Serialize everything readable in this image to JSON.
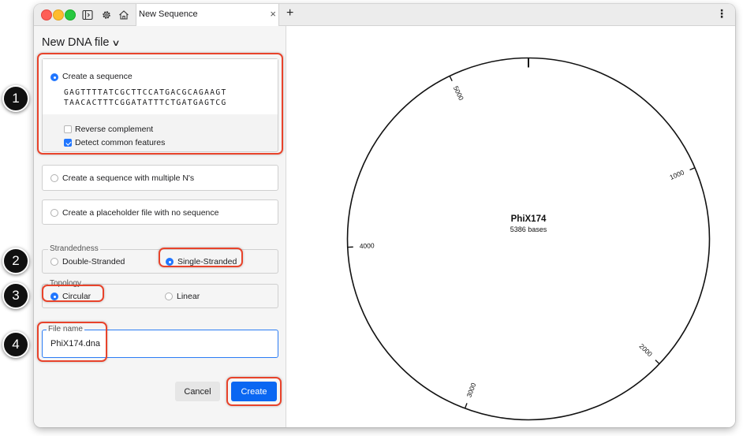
{
  "tab": {
    "title": "New Sequence",
    "close": "×",
    "add": "+",
    "menu": "⋮"
  },
  "header": {
    "title": "New DNA file"
  },
  "create_sequence": {
    "label": "Create a sequence",
    "sequence_line1": "GAGTTTTATCGCTTCCATGACGCAGAAGT",
    "sequence_line2": "TAACACTTTCGGATATTTCTGATGAGTCG",
    "reverse_complement": "Reverse complement",
    "detect_features": "Detect common features"
  },
  "option_multiple_n": "Create a sequence with multiple N's",
  "option_placeholder": "Create a placeholder file with no sequence",
  "strandedness": {
    "legend": "Strandedness",
    "double": "Double-Stranded",
    "single": "Single-Stranded"
  },
  "topology": {
    "legend": "Topology",
    "circular": "Circular",
    "linear": "Linear"
  },
  "file_name": {
    "legend": "File name",
    "value": "PhiX174.dna"
  },
  "buttons": {
    "cancel": "Cancel",
    "create": "Create"
  },
  "map": {
    "name": "PhiX174",
    "length_text": "5386 bases",
    "total_bases": 5386,
    "ticks": [
      "1000",
      "2000",
      "3000",
      "4000",
      "5000"
    ]
  },
  "callouts": [
    "1",
    "2",
    "3",
    "4"
  ],
  "colors": {
    "accent": "#2176ff",
    "highlight": "#e8432b",
    "primary_button": "#0a67f2"
  }
}
